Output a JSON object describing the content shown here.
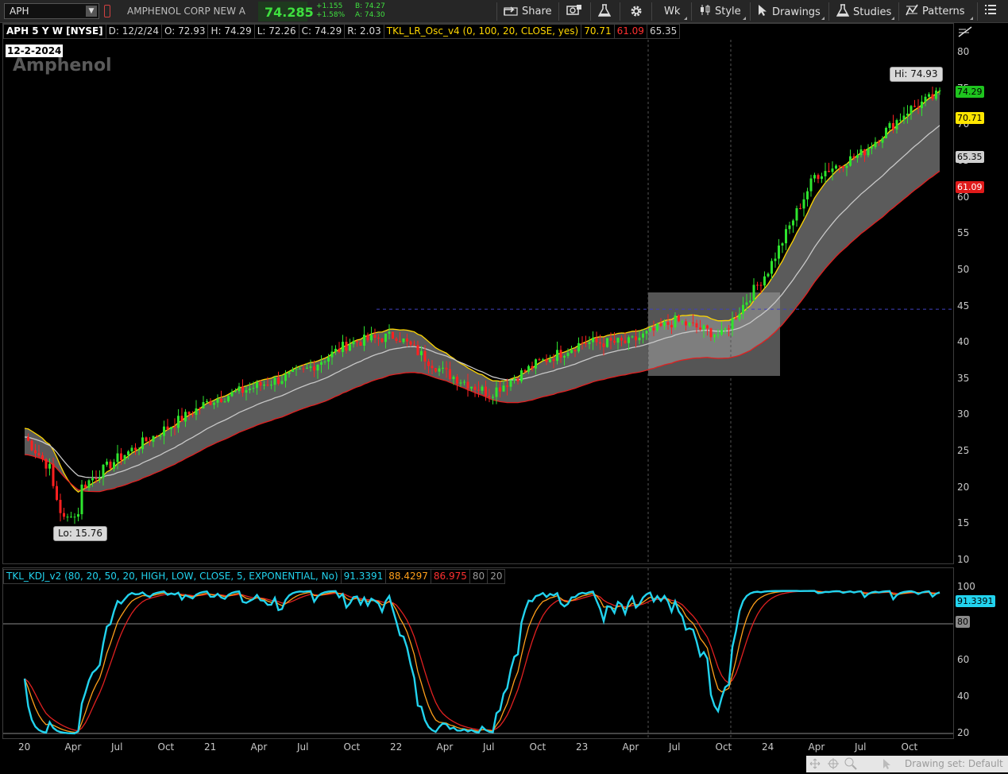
{
  "toolbar": {
    "symbol": "APH",
    "company": "AMPHENOL CORP NEW A",
    "last": "74.285",
    "change": "+1.155",
    "change_pct": "+1.58%",
    "bid": "B: 74.27",
    "ask": "A: 74.30",
    "share": "Share",
    "aggregation": "Wk",
    "style": "Style",
    "drawings": "Drawings",
    "studies": "Studies",
    "patterns": "Patterns"
  },
  "infobar": {
    "title": "APH 5 Y W [NYSE]",
    "date": "D: 12/2/24",
    "open": "O: 72.93",
    "high": "H: 74.29",
    "low": "L: 72.26",
    "close": "C: 74.29",
    "range": "R: 2.03",
    "study": "TKL_LR_Osc_v4 (0, 100, 20, CLOSE, yes)",
    "v1": "70.71",
    "v2": "61.09",
    "v3": "65.35"
  },
  "price_panel": {
    "date_tag": "12-2-2024",
    "watermark": "Amphenol",
    "hi_label": "Hi: 74.93",
    "lo_label": "Lo: 15.76",
    "y_ticks": [
      "80",
      "75",
      "70",
      "65",
      "60",
      "55",
      "50",
      "45",
      "40",
      "35",
      "30",
      "25",
      "20",
      "15",
      "10"
    ],
    "tag_price": "74.29",
    "tag_upper": "70.71",
    "tag_mid": "65.35",
    "tag_lower": "61.09",
    "colors": {
      "up": "#2ee52e",
      "down": "#ff2020",
      "upper": "#ffd700",
      "mid": "#c8c8c8",
      "lower": "#e02020",
      "channel_fill": "#7a7a7a"
    }
  },
  "kdj_panel": {
    "title": "TKL_KDJ_v2 (80, 20, 50, 20, HIGH, LOW, CLOSE, 5, EXPONENTIAL, No)",
    "k": "91.3391",
    "d": "88.4297",
    "j": "86.975",
    "ob": "80",
    "os": "20",
    "y_ticks": [
      "100",
      "80",
      "60",
      "40",
      "20"
    ],
    "tag_k": "91.3391",
    "tag_80": "80",
    "colors": {
      "k": "#22d3ee",
      "d": "#ff9f1a",
      "j": "#e02020"
    }
  },
  "x_axis": [
    "20",
    "Apr",
    "Jul",
    "Oct",
    "21",
    "Apr",
    "Jul",
    "Oct",
    "22",
    "Apr",
    "Jul",
    "Oct",
    "23",
    "Apr",
    "Jul",
    "Oct",
    "24",
    "Apr",
    "Jul",
    "Oct"
  ],
  "status": {
    "drawing_set": "Drawing set: Default"
  },
  "chart_data": {
    "type": "candlestick",
    "title": "APH 5 Y W [NYSE]",
    "ylim": [
      10,
      82
    ],
    "hi": 74.93,
    "lo": 15.76,
    "approx_close_by_quarter": [
      {
        "x": "2020-01",
        "y": 27
      },
      {
        "x": "2020-04",
        "y": 19
      },
      {
        "x": "2020-07",
        "y": 24
      },
      {
        "x": "2020-10",
        "y": 28
      },
      {
        "x": "2021-01",
        "y": 32
      },
      {
        "x": "2021-04",
        "y": 34
      },
      {
        "x": "2021-07",
        "y": 36
      },
      {
        "x": "2021-10",
        "y": 40
      },
      {
        "x": "2022-01",
        "y": 41
      },
      {
        "x": "2022-04",
        "y": 36
      },
      {
        "x": "2022-07",
        "y": 33
      },
      {
        "x": "2022-10",
        "y": 37
      },
      {
        "x": "2023-01",
        "y": 40
      },
      {
        "x": "2023-04",
        "y": 40
      },
      {
        "x": "2023-07",
        "y": 43
      },
      {
        "x": "2023-10",
        "y": 41
      },
      {
        "x": "2024-01",
        "y": 50
      },
      {
        "x": "2024-04",
        "y": 63
      },
      {
        "x": "2024-07",
        "y": 66
      },
      {
        "x": "2024-10",
        "y": 72
      },
      {
        "x": "2024-12",
        "y": 74.29
      }
    ]
  }
}
